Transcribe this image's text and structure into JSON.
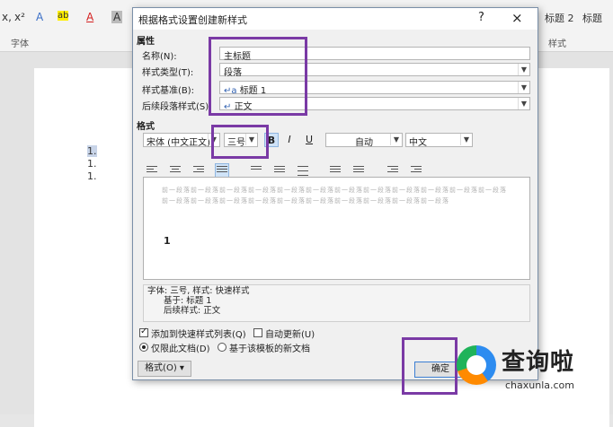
{
  "ribbon": {
    "tools": [
      "x,",
      "x²",
      "A",
      "ab",
      "A",
      "A"
    ],
    "group_font_label": "字体",
    "group_style_label": "样式",
    "style_gallery": [
      "标题 2",
      "标题"
    ]
  },
  "document": {
    "lines": [
      "1.",
      "1.",
      "1."
    ]
  },
  "dialog": {
    "title": "根据格式设置创建新样式",
    "help_label": "?",
    "close_label": "×",
    "properties_heading": "属性",
    "fields": {
      "name_label": "名称(N):",
      "name_value": "主标题",
      "type_label": "样式类型(T):",
      "type_value": "段落",
      "based_label": "样式基准(B):",
      "based_value": "标题 1",
      "next_label": "后续段落样式(S):",
      "next_value": "正文"
    },
    "format_heading": "格式",
    "format_bar": {
      "font": "宋体 (中文正文)",
      "size": "三号",
      "bold": "B",
      "italic": "I",
      "underline": "U",
      "color": "自动",
      "language": "中文"
    },
    "preview": {
      "sample_text": "前一段落前一段落前一段落前一段落前一段落前一段落前一段落前一段落前一段落前一段落前一段落前一段落前一段落前一段落前一段落前一段落前一段落前一段落前一段落前一段落前一段落前一段落",
      "heading_number": "1"
    },
    "description": [
      "字体: 三号, 样式: 快速样式",
      "基于: 标题 1",
      "后续样式: 正文"
    ],
    "options": {
      "add_to_gallery": "添加到快速样式列表(Q)",
      "auto_update": "自动更新(U)",
      "this_doc_only": "仅限此文档(D)",
      "new_docs": "基于该模板的新文档"
    },
    "format_button": "格式(O) ▾",
    "ok_button": "确定"
  },
  "watermark": {
    "title": "查询啦",
    "subtitle": "chaxunla.com"
  },
  "colors": {
    "highlight": "#7a3aa5",
    "watermark_blue": "#2d8cf0"
  }
}
